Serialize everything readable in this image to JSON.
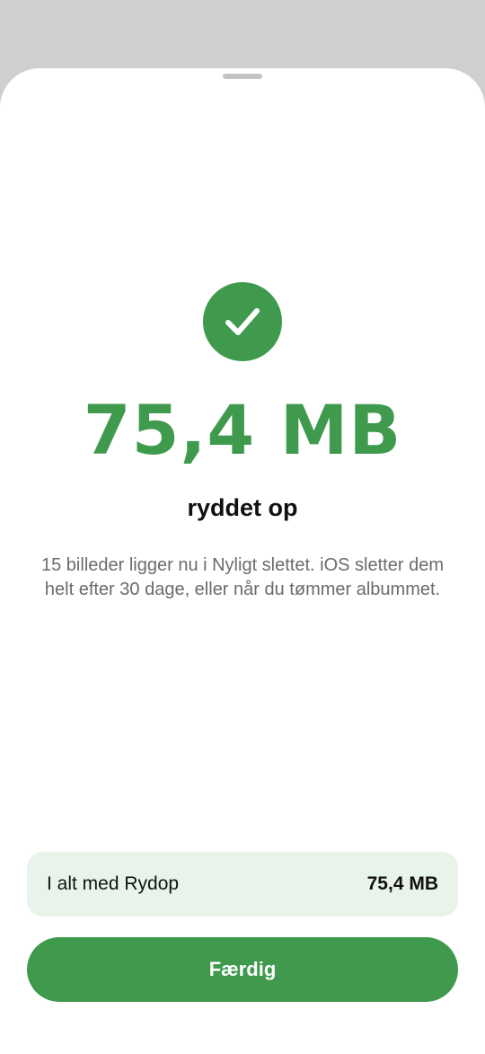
{
  "result": {
    "amount": "75,4 MB",
    "subtitle": "ryddet op",
    "description": "15 billeder ligger nu i Nyligt slettet. iOS sletter dem helt efter 30 dage, eller når du tømmer albummet."
  },
  "summary": {
    "label": "I alt med Rydop",
    "value": "75,4 MB"
  },
  "done_button": {
    "label": "Færdig"
  },
  "icons": {
    "success": "checkmark-circle-icon"
  },
  "colors": {
    "accent": "#3f9a4e",
    "summary_background": "#e8f4ea",
    "backdrop": "#cfcfcf"
  }
}
